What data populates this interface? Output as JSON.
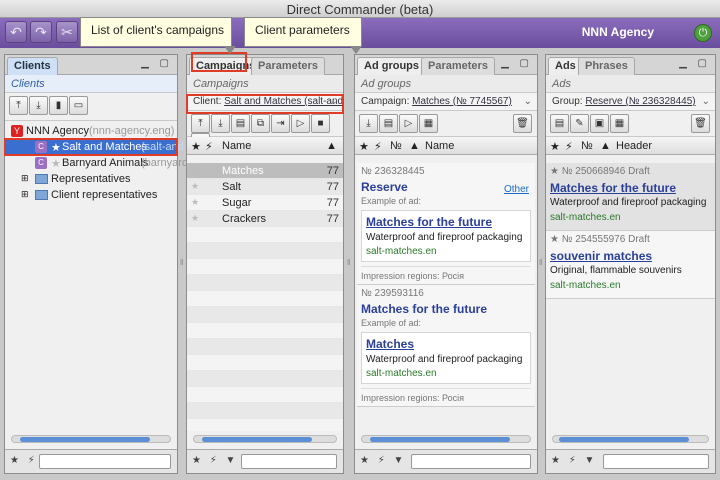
{
  "window": {
    "title": "Direct Commander (beta)"
  },
  "toolbar": {
    "undo_icon": "undo-icon",
    "redo_icon": "redo-icon",
    "scissors_icon": "scissors-icon",
    "brand": "NNN Agency",
    "exit_icon": "exit-icon"
  },
  "callouts": {
    "campaigns": "List of client's campaigns",
    "parameters": "Client parameters"
  },
  "clients": {
    "tab": "Clients",
    "subtitle": "Clients",
    "tree": {
      "root": "NNN Agency",
      "root_login": "(nnn-agency.eng)",
      "items": [
        {
          "label": "Salt and Matches",
          "login": "(salt-and",
          "selected": true
        },
        {
          "label": "Barnyard Animals",
          "login": "(barnyard",
          "selected": false
        }
      ],
      "groups": [
        "Representatives",
        "Client representatives"
      ]
    }
  },
  "campaigns": {
    "tabs": [
      "Campaigns",
      "Parameters"
    ],
    "subtitle": "Campaigns",
    "client_prefix": "Client:",
    "client_value": "Salt and Matches (salt-and...",
    "col_name": "Name",
    "rows": [
      {
        "name": "Matches",
        "id": "77",
        "selected": true
      },
      {
        "name": "Salt",
        "id": "77",
        "selected": false
      },
      {
        "name": "Sugar",
        "id": "77",
        "selected": false
      },
      {
        "name": "Crackers",
        "id": "77",
        "selected": false
      }
    ]
  },
  "adgroups": {
    "tabs": [
      "Ad groups",
      "Parameters"
    ],
    "subtitle": "Ad groups",
    "campaign_prefix": "Campaign:",
    "campaign_value": "Matches (№ 7745567)",
    "col_no": "№",
    "col_name": "Name",
    "cards": [
      {
        "id": "№ 236328445",
        "title": "Reserve",
        "example": "Example of ad:",
        "other": "Other",
        "ad_title": "Matches for the future",
        "ad_text": "Waterproof and fireproof packaging",
        "ad_domain": "salt-matches.en",
        "regions": "Impression regions: Росія"
      },
      {
        "id": "№ 239593116",
        "title": "Matches for the future",
        "example": "Example of ad:",
        "other": "",
        "ad_title": "Matches",
        "ad_text": "Waterproof and fireproof packaging",
        "ad_domain": "salt-matches.en",
        "regions": "Impression regions: Росія"
      }
    ]
  },
  "ads": {
    "tabs": [
      "Ads",
      "Phrases"
    ],
    "subtitle": "Ads",
    "group_prefix": "Group:",
    "group_value": "Reserve (№ 236328445)",
    "col_no": "№",
    "col_header": "Header",
    "items": [
      {
        "id": "№ 250668946",
        "status": "Draft",
        "title": "Matches for the future",
        "text": "Waterproof and fireproof packaging",
        "domain": "salt-matches.en",
        "selected": true
      },
      {
        "id": "№ 254555976",
        "status": "Draft",
        "title": "souvenir matches",
        "text": "Original, flammable souvenirs",
        "domain": "salt-matches.en",
        "selected": false
      }
    ]
  },
  "colors": {
    "toolbar": "#6a4d9c",
    "highlight": "#e03b26",
    "selected": "#3a6fd0",
    "link": "#2a3f9a"
  }
}
